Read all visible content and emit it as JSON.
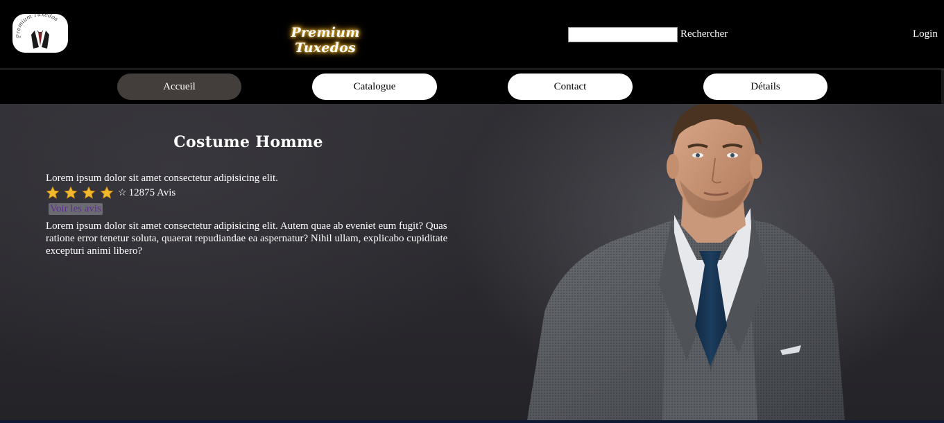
{
  "header": {
    "logo_text": "Premium Tuxedos",
    "site_title": "Premium Tuxedos",
    "search": {
      "value": "",
      "placeholder": "",
      "button_label": "Rechercher"
    },
    "login_label": "Login"
  },
  "nav": {
    "items": [
      {
        "label": "Accueil",
        "active": true
      },
      {
        "label": "Catalogue",
        "active": false
      },
      {
        "label": "Contact",
        "active": false
      },
      {
        "label": "Détails",
        "active": false
      }
    ]
  },
  "product": {
    "title": "Costume Homme",
    "tagline": "Lorem ipsum dolor sit amet consectetur adipisicing elit.",
    "rating": {
      "stars_filled": 4,
      "stars_total": 5,
      "count_text": "12875 Avis"
    },
    "reviews_link": "Voir les avis",
    "description": "Lorem ipsum dolor sit amet consectetur adipisicing elit. Autem quae ab eveniet eum fugit? Quas ratione error tenetur soluta, quaerat repudiandae ea aspernatur? Nihil ullam, explicabo cupiditate excepturi animi libero?"
  },
  "colors": {
    "page_background": "#000000",
    "active_nav": "#433e3b",
    "star": "#f2b92e",
    "title_glow": "#f5c84a",
    "link": "#5c2f8e"
  },
  "icons": [
    "logo-icon",
    "star-icon",
    "empty-star-icon"
  ]
}
